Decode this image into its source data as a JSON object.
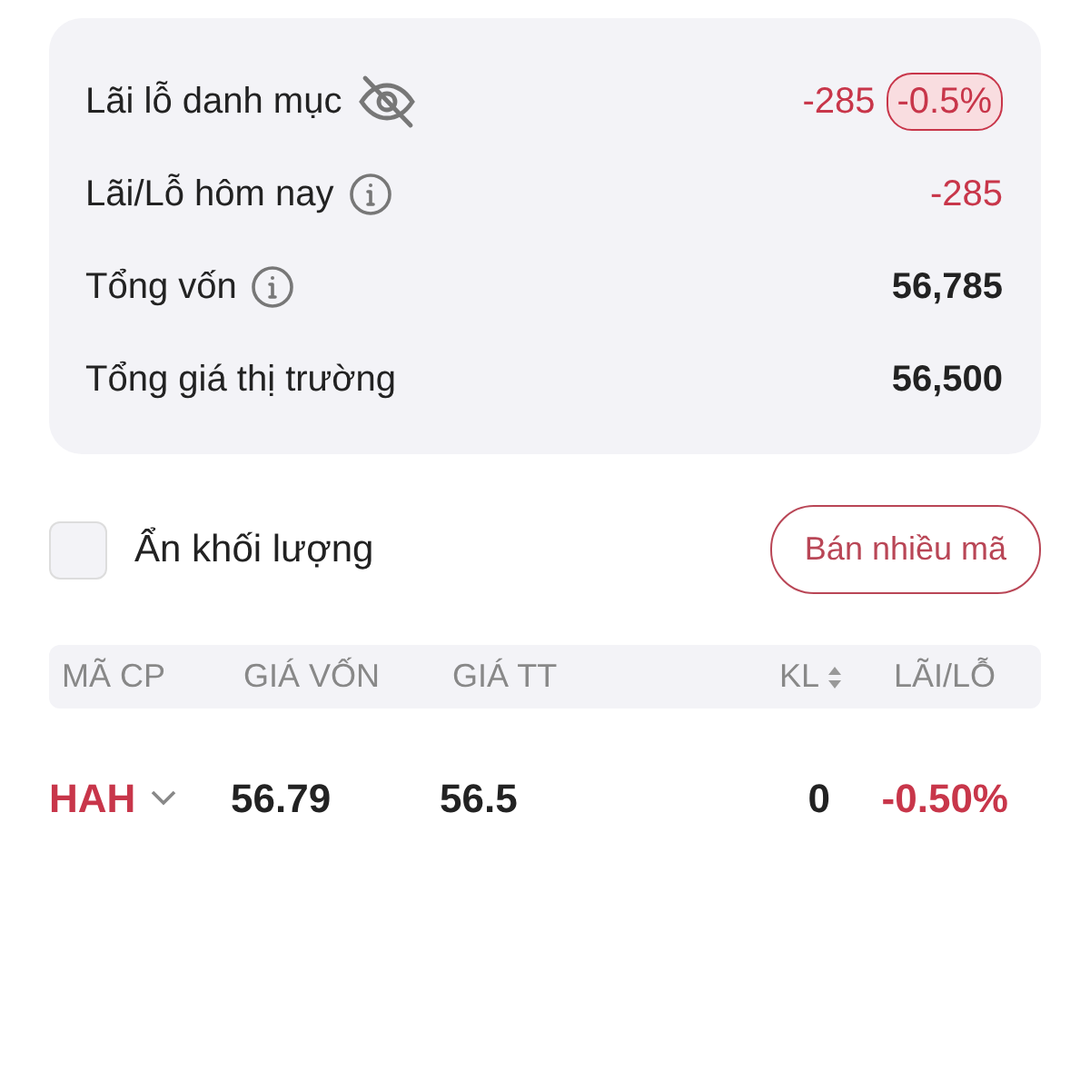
{
  "summary": [
    {
      "label": "Lãi lỗ danh mục",
      "kind": "hideable",
      "value": "-285",
      "color": "#c8364a",
      "badge": "-0.5%"
    },
    {
      "label": "Lãi/Lỗ hôm nay",
      "kind": "info",
      "value": "-285",
      "color": "#c8364a"
    },
    {
      "label": "Tổng vốn",
      "kind": "info",
      "value": "56,785",
      "color": "#222222"
    },
    {
      "label": "Tổng giá thị trường",
      "kind": "plain",
      "value": "56,500",
      "color": "#222222"
    }
  ],
  "hide_volume": {
    "label": "Ẩn khối lượng",
    "checked": false
  },
  "sell_button": "Bán nhiều mã",
  "table": {
    "columns": [
      {
        "label": "MÃ CP",
        "kind": "plain"
      },
      {
        "label": "GIÁ VỐN",
        "kind": "plain"
      },
      {
        "label": "GIÁ TT",
        "kind": "plain"
      },
      {
        "label": "KL",
        "kind": "sortable"
      },
      {
        "label": "LÃI/LỖ",
        "kind": "plain"
      }
    ],
    "rows": [
      {
        "cells": [
          "HAH",
          "56.79",
          "56.5",
          "0",
          "-0.50%"
        ],
        "color": "#c8364a",
        "expanded": false
      }
    ]
  }
}
